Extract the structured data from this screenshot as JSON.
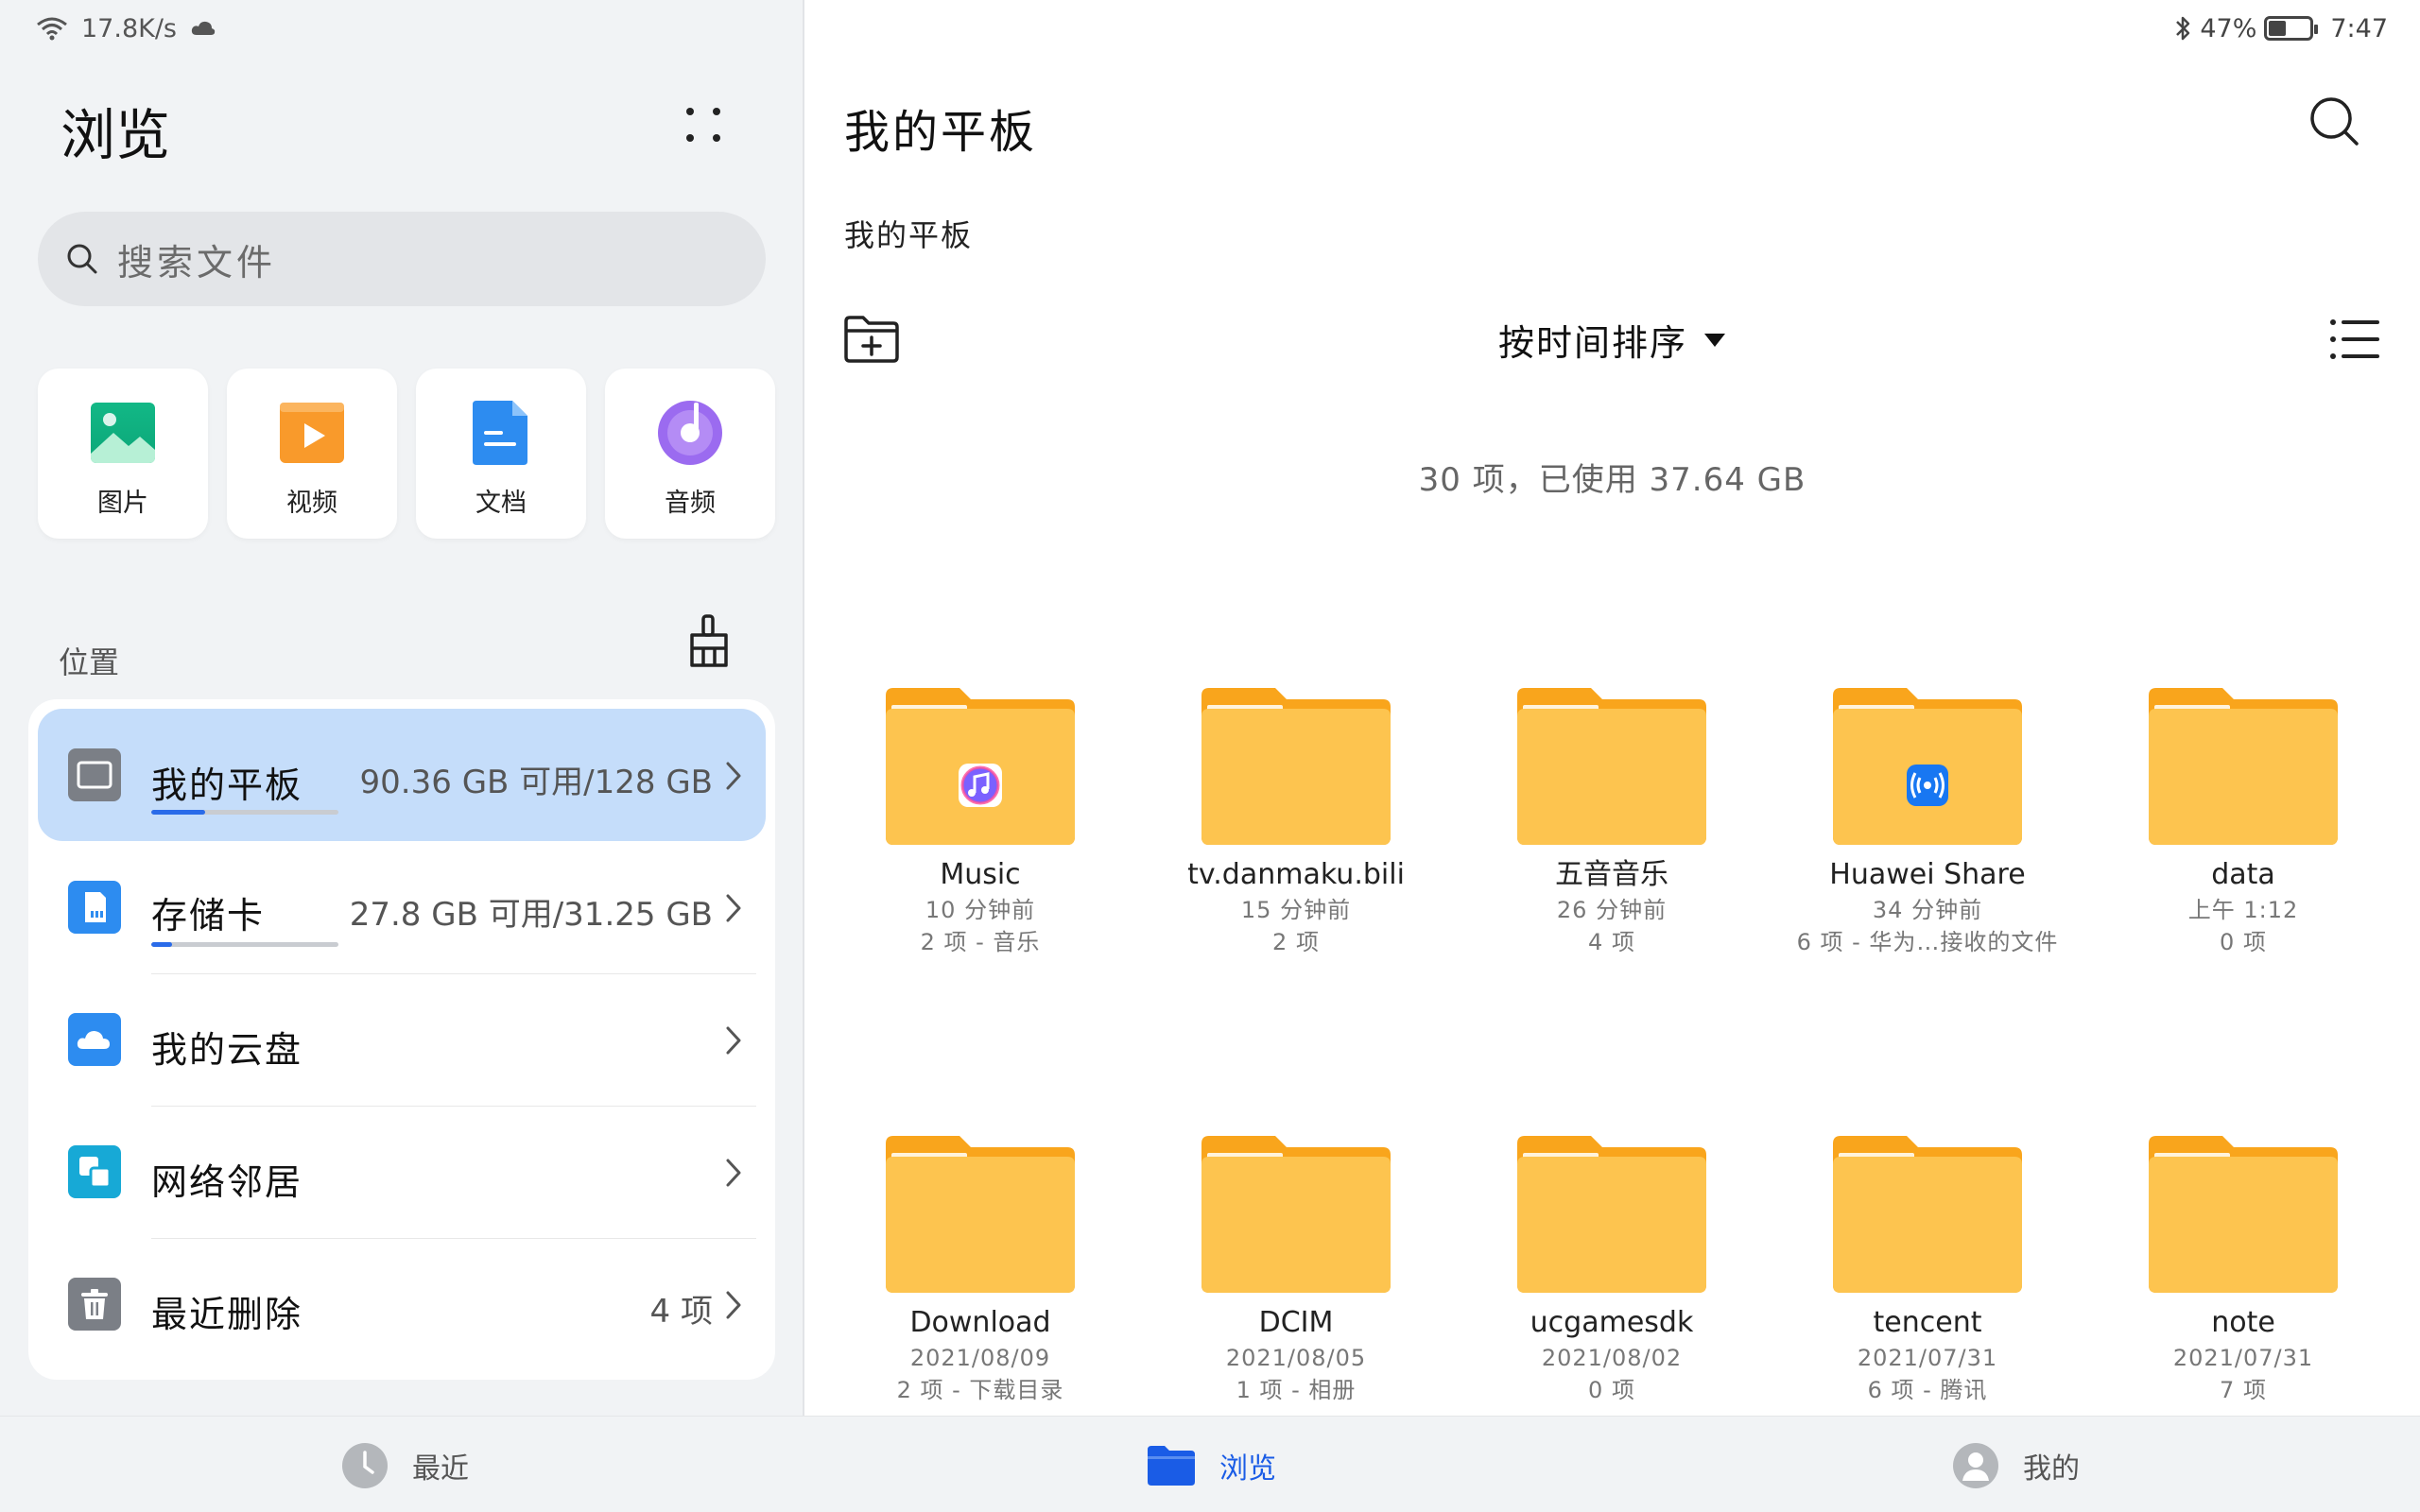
{
  "status": {
    "net_speed": "17.8K/s",
    "battery": "47%",
    "battery_level": 0.47,
    "time": "7:47"
  },
  "sidebar": {
    "title": "浏览",
    "search_placeholder": "搜索文件",
    "categories": [
      {
        "label": "图片",
        "icon": "image-icon"
      },
      {
        "label": "视频",
        "icon": "video-icon"
      },
      {
        "label": "文档",
        "icon": "document-icon"
      },
      {
        "label": "音频",
        "icon": "audio-icon"
      }
    ],
    "locations_header": "位置",
    "locations": [
      {
        "name": "我的平板",
        "info": "90.36 GB 可用/128 GB",
        "usage": 0.29,
        "icon": "tablet-icon",
        "active": true
      },
      {
        "name": "存储卡",
        "info": "27.8 GB 可用/31.25 GB",
        "usage": 0.11,
        "icon": "sd-card-icon"
      },
      {
        "name": "我的云盘",
        "info": "",
        "icon": "cloud-icon"
      },
      {
        "name": "网络邻居",
        "info": "",
        "icon": "network-icon"
      },
      {
        "name": "最近删除",
        "info": "4 项",
        "icon": "trash-icon"
      }
    ]
  },
  "main": {
    "title": "我的平板",
    "breadcrumb": "我的平板",
    "sort_label": "按时间排序",
    "summary": "30 项，已使用 37.64 GB",
    "files": [
      {
        "name": "Music",
        "meta1": "10 分钟前",
        "meta2": "2 项 - 音乐",
        "badge": "music"
      },
      {
        "name": "tv.danmaku.bili",
        "meta1": "15 分钟前",
        "meta2": "2 项"
      },
      {
        "name": "五音音乐",
        "meta1": "26 分钟前",
        "meta2": "4 项"
      },
      {
        "name": "Huawei Share",
        "meta1": "34 分钟前",
        "meta2": "6 项 - 华为…接收的文件",
        "badge": "share"
      },
      {
        "name": "data",
        "meta1": "上午 1:12",
        "meta2": "0 项"
      },
      {
        "name": "Download",
        "meta1": "2021/08/09",
        "meta2": "2 项 - 下载目录"
      },
      {
        "name": "DCIM",
        "meta1": "2021/08/05",
        "meta2": "1 项 - 相册"
      },
      {
        "name": "ucgamesdk",
        "meta1": "2021/08/02",
        "meta2": "0 项"
      },
      {
        "name": "tencent",
        "meta1": "2021/07/31",
        "meta2": "6 项 - 腾讯"
      },
      {
        "name": "note",
        "meta1": "2021/07/31",
        "meta2": "7 项"
      }
    ]
  },
  "bottom_nav": [
    {
      "label": "最近",
      "icon": "clock-icon"
    },
    {
      "label": "浏览",
      "icon": "folder-icon",
      "active": true
    },
    {
      "label": "我的",
      "icon": "profile-icon"
    }
  ],
  "colors": {
    "accent": "#1a5ce6",
    "folder": "#fdc44f",
    "folder_tab": "#f9a51c",
    "active_row": "#c5ddfa"
  }
}
